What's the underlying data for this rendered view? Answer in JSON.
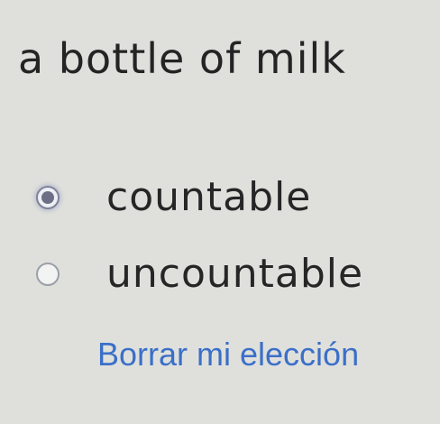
{
  "question": {
    "text": "a bottle of milk"
  },
  "options": [
    {
      "label": "countable",
      "selected": true
    },
    {
      "label": "uncountable",
      "selected": false
    }
  ],
  "clear_choice": {
    "label": "Borrar mi elección"
  },
  "colors": {
    "background": "#dfe0dc",
    "link": "#3b6fc8",
    "radio_selected": "#6d6f86"
  }
}
